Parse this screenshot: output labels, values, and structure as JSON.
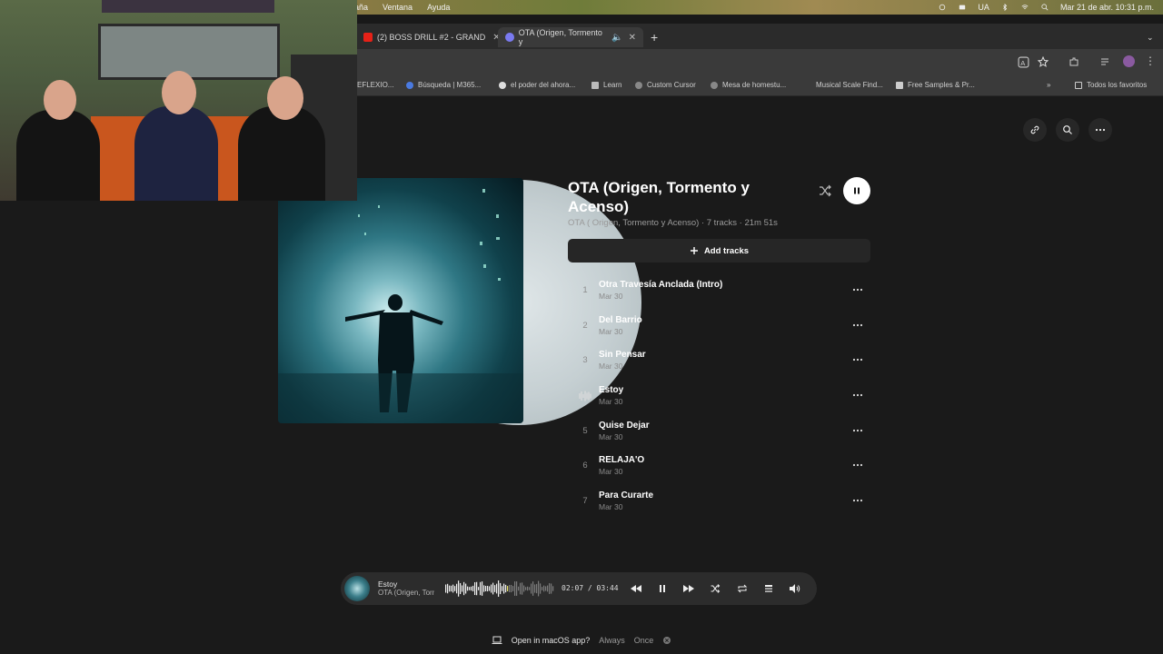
{
  "menubar": {
    "items": [
      "aña",
      "Ventana",
      "Ayuda"
    ],
    "input_source": "UA",
    "datetime": "Mar 21 de abr.  10:31 p.m."
  },
  "tabs": [
    {
      "label": "(2) BOSS DRILL #2 - GRAND",
      "color": "#e62117"
    },
    {
      "label": "OTA (Origen, Tormento y",
      "color": "#7a7af0"
    }
  ],
  "bookmarks": [
    "EFLEXIO...",
    "Búsqueda | M365...",
    "el poder del ahora...",
    "Learn",
    "Custom Cursor",
    "Mesa de homestu...",
    "Musical Scale Find...",
    "Free Samples & Pr...",
    "Todos los favoritos"
  ],
  "album": {
    "title": "OTA (Origen, Tormento y Acenso)",
    "meta": "OTA ( Origen, Tormento y Acenso) · 7 tracks · 21m 51s",
    "add_tracks": "Add tracks"
  },
  "tracks": [
    {
      "num": "1",
      "title": "Otra Travesía Anclada (Intro)",
      "date": "Mar 30",
      "playing": false
    },
    {
      "num": "2",
      "title": "Del Barrio",
      "date": "Mar 30",
      "playing": false
    },
    {
      "num": "3",
      "title": "Sin Pensar",
      "date": "Mar 30",
      "playing": false
    },
    {
      "num": "4",
      "title": "Estoy",
      "date": "Mar 30",
      "playing": true
    },
    {
      "num": "5",
      "title": "Quise Dejar",
      "date": "Mar 30",
      "playing": false
    },
    {
      "num": "6",
      "title": "RELAJA'O",
      "date": "Mar 30",
      "playing": false
    },
    {
      "num": "7",
      "title": "Para Curarte",
      "date": "Mar 30",
      "playing": false
    }
  ],
  "player": {
    "title": "Estoy",
    "subtitle": "OTA (Origen, Tormento y Acenso)",
    "time": "02:07  /  03:44",
    "progress": 0.567
  },
  "open_bar": {
    "prompt": "Open in macOS app?",
    "always": "Always",
    "once": "Once"
  },
  "colors": {
    "background": "#1a1a1a",
    "player_bg": "#2c2c2c",
    "progress_accent": "#e8e26a"
  }
}
